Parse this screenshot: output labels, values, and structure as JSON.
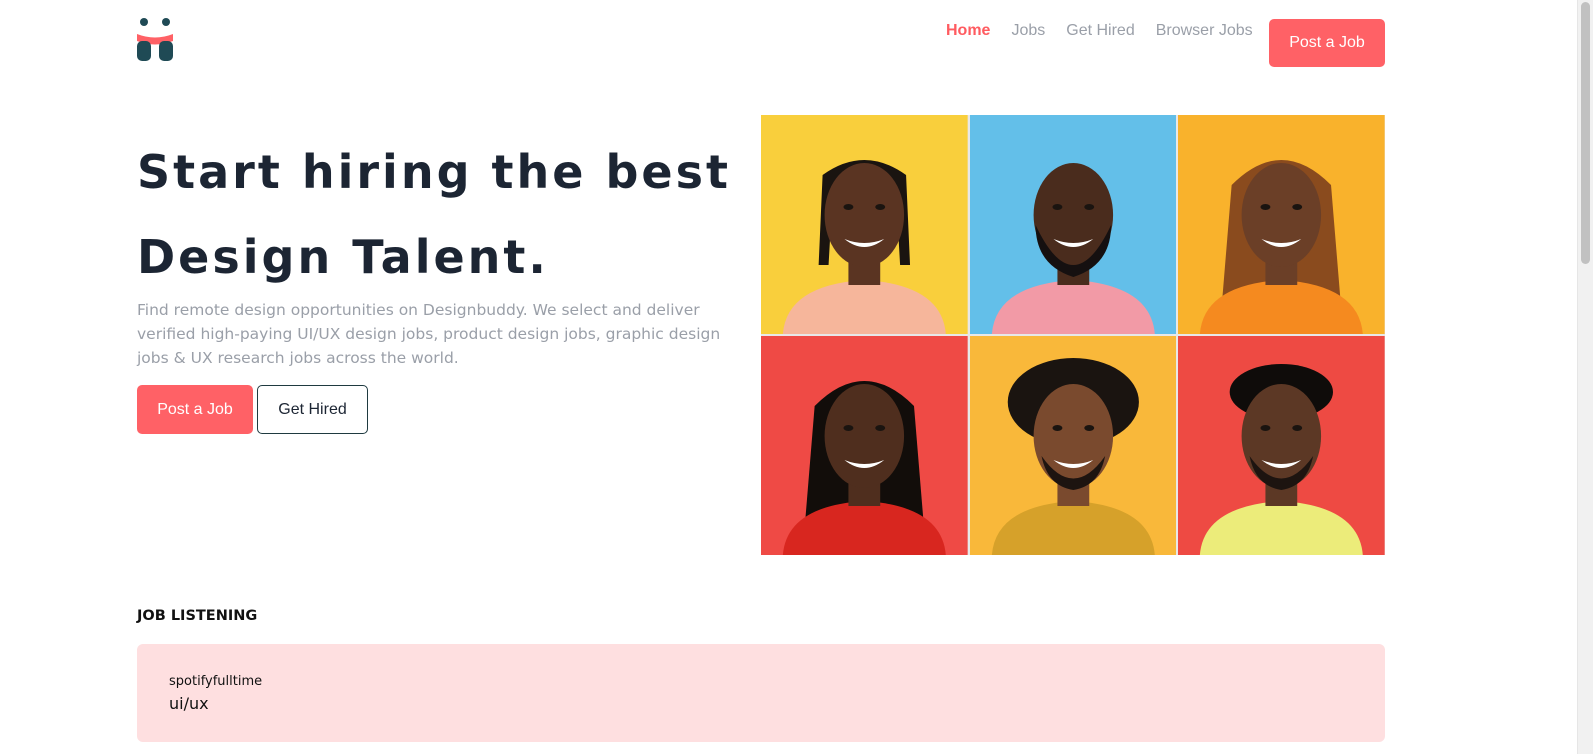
{
  "header": {
    "logo_alt": "logo",
    "nav": [
      {
        "label": "Home",
        "active": true
      },
      {
        "label": "Jobs",
        "active": false
      },
      {
        "label": "Get Hired",
        "active": false
      },
      {
        "label": "Browser Jobs",
        "active": false
      }
    ],
    "cta_label": "Post a Job"
  },
  "hero": {
    "title_line1": "Start hiring the best",
    "title_line2": "Design Talent.",
    "description": "Find remote design opportunities on Designbuddy. We select and deliver verified high-paying UI/UX design jobs, product design jobs, graphic design jobs & UX research jobs across the world.",
    "primary_button": "Post a Job",
    "secondary_button": "Get Hired"
  },
  "photos": [
    {
      "name": "portrait-1",
      "bg": "#f9cf3c"
    },
    {
      "name": "portrait-2",
      "bg": "#63bfe9"
    },
    {
      "name": "portrait-3",
      "bg": "#f9b22c"
    },
    {
      "name": "portrait-4",
      "bg": "#ef4a45"
    },
    {
      "name": "portrait-5",
      "bg": "#f9b83a"
    },
    {
      "name": "portrait-6",
      "bg": "#ee4a43"
    }
  ],
  "jobs": {
    "section_title": "JOB LISTENING",
    "items": [
      {
        "company": "spotifyfulltime",
        "title": "ui/ux"
      }
    ]
  },
  "colors": {
    "accent": "#ff6166",
    "text_dark": "#1c2533",
    "text_muted": "#9a9fa8",
    "card_bg": "#fedfe0"
  }
}
